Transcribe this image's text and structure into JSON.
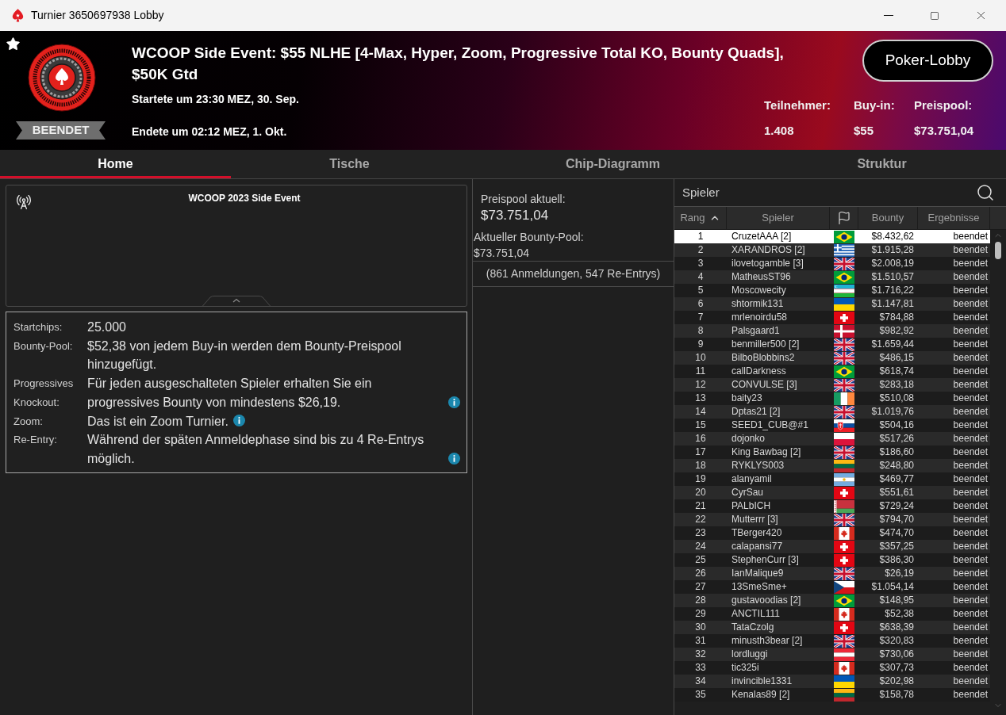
{
  "window": {
    "title": "Turnier 3650697938 Lobby"
  },
  "header": {
    "status": "BEENDET",
    "title": "WCOOP Side Event: $55 NLHE [4-Max, Hyper, Zoom, Progressive Total KO, Bounty Quads], $50K Gtd",
    "started": "Startete um 23:30 MEZ, 30. Sep.",
    "ended": "Endete um 02:12 MEZ, 1. Okt.",
    "lobby_button": "Poker-Lobby",
    "stats": [
      {
        "label": "Teilnehmer:",
        "value": "1.408"
      },
      {
        "label": "Buy-in:",
        "value": "$55"
      },
      {
        "label": "Preispool:",
        "value": "$73.751,04"
      }
    ]
  },
  "tabs": [
    {
      "label": "Home",
      "selected": true
    },
    {
      "label": "Tische",
      "selected": false
    },
    {
      "label": "Chip-Diagramm",
      "selected": false
    },
    {
      "label": "Struktur",
      "selected": false
    }
  ],
  "news": {
    "title": "WCOOP 2023 Side Event"
  },
  "details": [
    {
      "label": "Startchips:",
      "value": "25.000",
      "info": false
    },
    {
      "label": "Bounty-Pool:",
      "value": "$52,38 von jedem Buy-in werden dem Bounty-Preispool hinzugefügt.",
      "info": false
    },
    {
      "label": "Progressives Knockout:",
      "value": "Für jeden ausgeschalteten Spieler erhalten Sie ein progressives Bounty von mindestens $26,19.",
      "info": true
    },
    {
      "label": "Zoom:",
      "value": "Das ist ein Zoom Turnier.",
      "info": true
    },
    {
      "label": "Re-Entry:",
      "value": "Während der späten Anmeldephase sind bis zu 4 Re-Entrys möglich.",
      "info": true
    }
  ],
  "prize_panel": {
    "prize_label": "Preispool aktuell:",
    "prize_value": "$73.751,04",
    "bounty_label": "Aktueller Bounty-Pool:",
    "bounty_value": "$73.751,04",
    "entries": "(861 Anmeldungen, 547 Re-Entrys)"
  },
  "players": {
    "title": "Spieler",
    "columns": [
      {
        "kind": "text",
        "label": "Rang",
        "sorted": true
      },
      {
        "kind": "text",
        "label": "Spieler",
        "sorted": false
      },
      {
        "kind": "icon",
        "sorted": false
      },
      {
        "kind": "text",
        "label": "Bounty",
        "sorted": false
      },
      {
        "kind": "text",
        "label": "Ergebnisse",
        "sorted": false
      }
    ],
    "rows": [
      {
        "rank": "1",
        "name": "CruzetAAA [2]",
        "flag": {
          "kind": "brazil"
        },
        "bounty": "$8.432,62",
        "result": "beendet",
        "selected": true
      },
      {
        "rank": "2",
        "name": "XARANDROS [2]",
        "flag": {
          "kind": "greece"
        },
        "bounty": "$1.915,28",
        "result": "beendet",
        "selected": false
      },
      {
        "rank": "3",
        "name": "ilovetogamble [3]",
        "flag": {
          "kind": "uk"
        },
        "bounty": "$2.008,19",
        "result": "beendet",
        "selected": false
      },
      {
        "rank": "4",
        "name": "MatheusST96",
        "flag": {
          "kind": "brazil"
        },
        "bounty": "$1.510,57",
        "result": "beendet",
        "selected": false
      },
      {
        "rank": "5",
        "name": "Moscowecity",
        "flag": {
          "kind": "uzbekistan"
        },
        "bounty": "$1.716,22",
        "result": "beendet",
        "selected": false
      },
      {
        "rank": "6",
        "name": "shtormik131",
        "flag": {
          "kind": "ukraine"
        },
        "bounty": "$1.147,81",
        "result": "beendet",
        "selected": false
      },
      {
        "rank": "7",
        "name": "mrlenoirdu58",
        "flag": {
          "kind": "switzerland"
        },
        "bounty": "$784,88",
        "result": "beendet",
        "selected": false
      },
      {
        "rank": "8",
        "name": "Palsgaard1",
        "flag": {
          "kind": "denmark"
        },
        "bounty": "$982,92",
        "result": "beendet",
        "selected": false
      },
      {
        "rank": "9",
        "name": "benmiller500 [2]",
        "flag": {
          "kind": "uk"
        },
        "bounty": "$1.659,44",
        "result": "beendet",
        "selected": false
      },
      {
        "rank": "10",
        "name": "BilboBlobbins2",
        "flag": {
          "kind": "uk"
        },
        "bounty": "$486,15",
        "result": "beendet",
        "selected": false
      },
      {
        "rank": "11",
        "name": "callDarkness",
        "flag": {
          "kind": "brazil"
        },
        "bounty": "$618,74",
        "result": "beendet",
        "selected": false
      },
      {
        "rank": "12",
        "name": "CONVULSE [3]",
        "flag": {
          "kind": "uk"
        },
        "bounty": "$283,18",
        "result": "beendet",
        "selected": false
      },
      {
        "rank": "13",
        "name": "baity23",
        "flag": {
          "kind": "ireland"
        },
        "bounty": "$510,08",
        "result": "beendet",
        "selected": false
      },
      {
        "rank": "14",
        "name": "Dptas21 [2]",
        "flag": {
          "kind": "uk"
        },
        "bounty": "$1.019,76",
        "result": "beendet",
        "selected": false
      },
      {
        "rank": "15",
        "name": "SEED1_CUB@#1",
        "flag": {
          "kind": "slovakia"
        },
        "bounty": "$504,16",
        "result": "beendet",
        "selected": false
      },
      {
        "rank": "16",
        "name": "dojonko",
        "flag": {
          "kind": "poland"
        },
        "bounty": "$517,26",
        "result": "beendet",
        "selected": false
      },
      {
        "rank": "17",
        "name": "King Bawbag [2]",
        "flag": {
          "kind": "uk"
        },
        "bounty": "$186,60",
        "result": "beendet",
        "selected": false
      },
      {
        "rank": "18",
        "name": "RYKLYS003",
        "flag": {
          "kind": "lithuania"
        },
        "bounty": "$248,80",
        "result": "beendet",
        "selected": false
      },
      {
        "rank": "19",
        "name": "alanyamil",
        "flag": {
          "kind": "argentina"
        },
        "bounty": "$469,77",
        "result": "beendet",
        "selected": false
      },
      {
        "rank": "20",
        "name": "CyrSau",
        "flag": {
          "kind": "switzerland"
        },
        "bounty": "$551,61",
        "result": "beendet",
        "selected": false
      },
      {
        "rank": "21",
        "name": "PALbICH",
        "flag": {
          "kind": "belarus"
        },
        "bounty": "$729,24",
        "result": "beendet",
        "selected": false
      },
      {
        "rank": "22",
        "name": "Mutterrr [3]",
        "flag": {
          "kind": "uk"
        },
        "bounty": "$794,70",
        "result": "beendet",
        "selected": false
      },
      {
        "rank": "23",
        "name": "TBerger420",
        "flag": {
          "kind": "canada"
        },
        "bounty": "$474,70",
        "result": "beendet",
        "selected": false
      },
      {
        "rank": "24",
        "name": "calapansi77",
        "flag": {
          "kind": "switzerland"
        },
        "bounty": "$357,25",
        "result": "beendet",
        "selected": false
      },
      {
        "rank": "25",
        "name": "StephenCurr [3]",
        "flag": {
          "kind": "switzerland"
        },
        "bounty": "$386,30",
        "result": "beendet",
        "selected": false
      },
      {
        "rank": "26",
        "name": "IanMalique9",
        "flag": {
          "kind": "uk"
        },
        "bounty": "$26,19",
        "result": "beendet",
        "selected": false
      },
      {
        "rank": "27",
        "name": "13SmeSme+",
        "flag": {
          "kind": "czech"
        },
        "bounty": "$1.054,14",
        "result": "beendet",
        "selected": false
      },
      {
        "rank": "28",
        "name": "gustavoodias [2]",
        "flag": {
          "kind": "brazil"
        },
        "bounty": "$148,95",
        "result": "beendet",
        "selected": false
      },
      {
        "rank": "29",
        "name": "ANCTIL111",
        "flag": {
          "kind": "canada"
        },
        "bounty": "$52,38",
        "result": "beendet",
        "selected": false
      },
      {
        "rank": "30",
        "name": "TataCzolg",
        "flag": {
          "kind": "switzerland"
        },
        "bounty": "$638,39",
        "result": "beendet",
        "selected": false
      },
      {
        "rank": "31",
        "name": "minusth3bear [2]",
        "flag": {
          "kind": "uk"
        },
        "bounty": "$320,83",
        "result": "beendet",
        "selected": false
      },
      {
        "rank": "32",
        "name": "lordluggi",
        "flag": {
          "kind": "austria"
        },
        "bounty": "$730,06",
        "result": "beendet",
        "selected": false
      },
      {
        "rank": "33",
        "name": "tic325i",
        "flag": {
          "kind": "canada"
        },
        "bounty": "$307,73",
        "result": "beendet",
        "selected": false
      },
      {
        "rank": "34",
        "name": "invincible1331",
        "flag": {
          "kind": "ukraine"
        },
        "bounty": "$202,98",
        "result": "beendet",
        "selected": false
      },
      {
        "rank": "35",
        "name": "Kenalas89 [2]",
        "flag": {
          "kind": "lithuania"
        },
        "bounty": "$158,78",
        "result": "beendet",
        "selected": false
      }
    ]
  }
}
